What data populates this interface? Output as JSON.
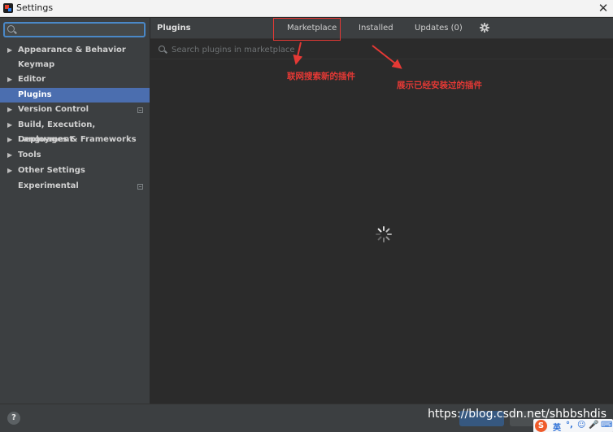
{
  "window": {
    "title": "Settings",
    "close_glyph": "✕",
    "icon": "intellij-app-icon"
  },
  "sidebar": {
    "search": {
      "value": "",
      "placeholder": "",
      "icon": "search-icon"
    },
    "items": [
      {
        "label": "Appearance & Behavior",
        "expandable": true,
        "selected": false,
        "project_badge": false
      },
      {
        "label": "Keymap",
        "expandable": false,
        "selected": false,
        "project_badge": false
      },
      {
        "label": "Editor",
        "expandable": true,
        "selected": false,
        "project_badge": false
      },
      {
        "label": "Plugins",
        "expandable": false,
        "selected": true,
        "project_badge": false
      },
      {
        "label": "Version Control",
        "expandable": true,
        "selected": false,
        "project_badge": true
      },
      {
        "label": "Build, Execution, Deployment",
        "expandable": true,
        "selected": false,
        "project_badge": false
      },
      {
        "label": "Languages & Frameworks",
        "expandable": true,
        "selected": false,
        "project_badge": false
      },
      {
        "label": "Tools",
        "expandable": true,
        "selected": false,
        "project_badge": false
      },
      {
        "label": "Other Settings",
        "expandable": true,
        "selected": false,
        "project_badge": false
      },
      {
        "label": "Experimental",
        "expandable": false,
        "selected": false,
        "project_badge": true
      }
    ],
    "arrow_glyph": "▶"
  },
  "content": {
    "title": "Plugins",
    "tabs": {
      "marketplace": "Marketplace",
      "installed": "Installed",
      "updates": "Updates (0)"
    },
    "settings_icon": "gear-icon",
    "search": {
      "value": "",
      "placeholder": "Search plugins in marketplace"
    },
    "annotations": {
      "marketplace_note": "联网搜索新的插件",
      "installed_note": "展示已经安装过的插件"
    },
    "loading_icon": "spinner-icon"
  },
  "bottombar": {
    "help_label": "?",
    "watermark": "https://blog.csdn.net/shbbshdis",
    "ime": {
      "logo": "S",
      "chars": [
        "英",
        "°,",
        "☺",
        "🎤",
        "⌨"
      ]
    }
  },
  "colors": {
    "sidebar_bg": "#3c3f41",
    "content_bg": "#2b2b2b",
    "selection": "#4b6eaf",
    "annotation_red": "#e53935",
    "focus_border": "#4a88c7"
  }
}
